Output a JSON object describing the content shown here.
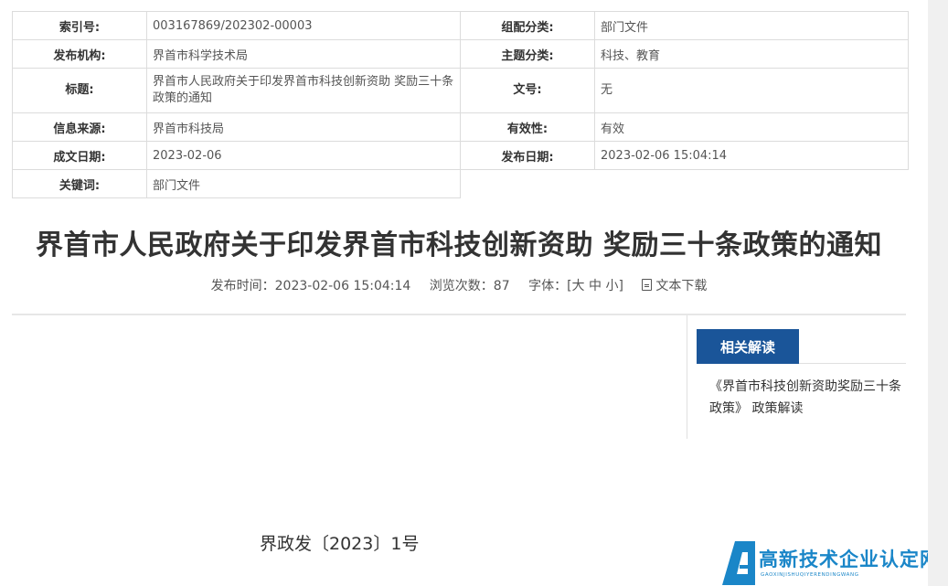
{
  "meta": {
    "index_label": "索引号:",
    "index_value": "003167869/202302-00003",
    "category_label": "组配分类:",
    "category_value": "部门文件",
    "publisher_label": "发布机构:",
    "publisher_value": "界首市科学技术局",
    "topic_label": "主题分类:",
    "topic_value": "科技、教育",
    "title_label": "标题:",
    "title_value": "界首市人民政府关于印发界首市科技创新资助 奖励三十条政策的通知",
    "docnum_label": "文号:",
    "docnum_value": "无",
    "source_label": "信息来源:",
    "source_value": "界首市科技局",
    "validity_label": "有效性:",
    "validity_value": "有效",
    "created_label": "成文日期:",
    "created_value": "2023-02-06",
    "published_label": "发布日期:",
    "published_value": "2023-02-06 15:04:14",
    "keywords_label": "关键词:",
    "keywords_value": "部门文件"
  },
  "article": {
    "title": "界首市人民政府关于印发界首市科技创新资助 奖励三十条政策的通知",
    "publish_time": "发布时间：2023-02-06 15:04:14",
    "views": "浏览次数：87",
    "font_label": "字体：[大 中 小]",
    "download_label": "文本下载",
    "doc_number": "界政发〔2023〕1号"
  },
  "related": {
    "heading": "相关解读",
    "link": "《界首市科技创新资助奖励三十条政策》 政策解读"
  },
  "logo": {
    "name": "高新技术企业认定网",
    "pinyin": "GAOXINJISHUQIYERENDINGWANG",
    "brand_color": "#1a86c8"
  },
  "colors": {
    "accent": "#1a5599"
  }
}
